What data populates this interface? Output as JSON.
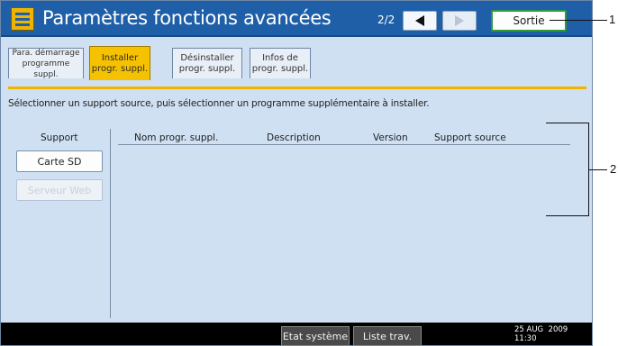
{
  "titlebar": {
    "title": "Paramètres fonctions avancées",
    "page_indicator": "2/2",
    "exit_label": "Sortie"
  },
  "tabs": [
    {
      "label": "Para. démarrage\nprogramme suppl.",
      "active": false
    },
    {
      "label": "Installer\nprogr. suppl.",
      "active": true
    },
    {
      "label": "Désinstaller\nprogr. suppl.",
      "active": false
    },
    {
      "label": "Infos de\nprogr. suppl.",
      "active": false
    }
  ],
  "instruction": "Sélectionner un support source, puis sélectionner un programme supplémentaire à installer.",
  "support": {
    "label": "Support",
    "buttons": [
      {
        "label": "Carte SD",
        "enabled": true
      },
      {
        "label": "Serveur Web",
        "enabled": false
      }
    ]
  },
  "table": {
    "columns": [
      "Nom progr. suppl.",
      "Description",
      "Version",
      "Support source"
    ]
  },
  "statusbar": {
    "system_status": "Etat système",
    "job_list": "Liste trav.",
    "date": "25 AUG  2009",
    "time": "11:30"
  },
  "callouts": [
    "1",
    "2"
  ],
  "colors": {
    "title_bar": "#1f5fa8",
    "active_tab": "#f6c200",
    "panel_bg": "#cfe0f2",
    "exit_border": "#2e9a3a"
  }
}
